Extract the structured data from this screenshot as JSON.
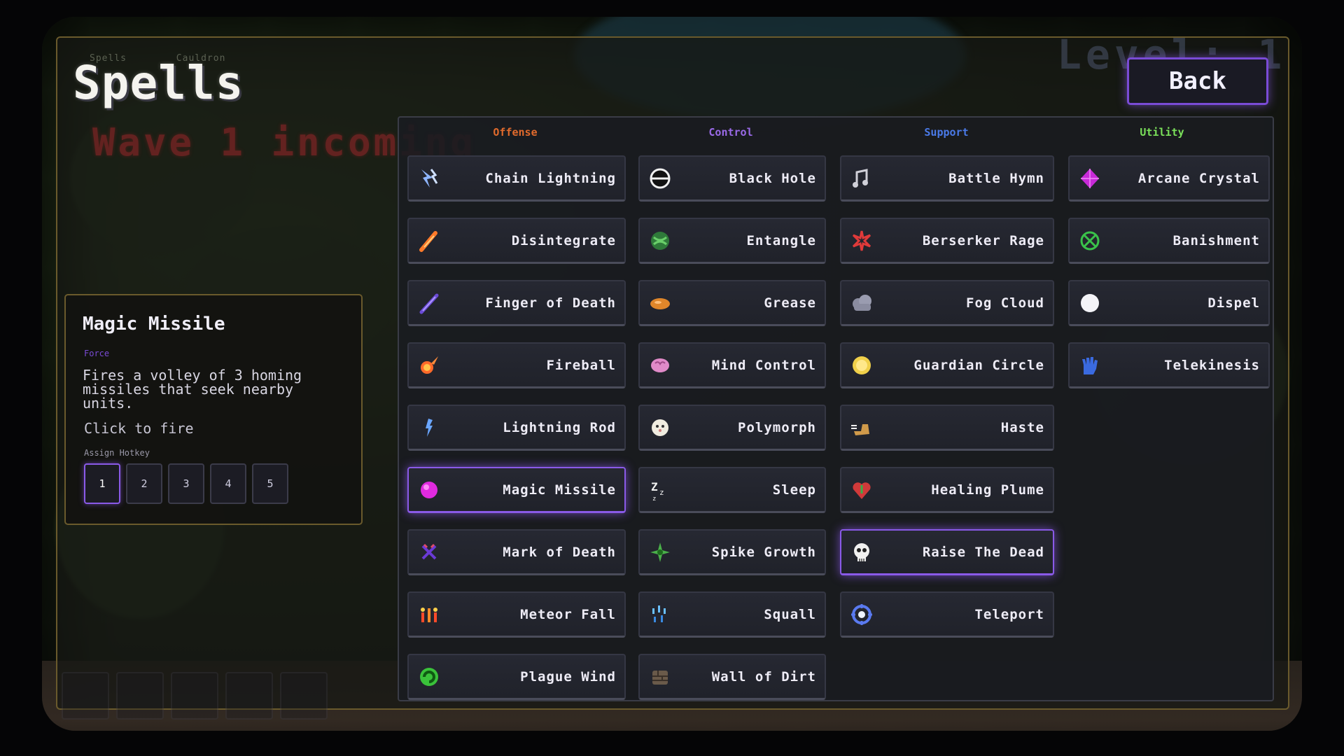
{
  "screen": {
    "title": "Spells",
    "ghost_tabs": [
      "Spells",
      "Cauldron"
    ],
    "wave_text": "Wave 1 incoming",
    "level_text": "Level: 1",
    "back_label": "Back"
  },
  "columns": [
    {
      "label": "Offense",
      "color": "#e06a2c"
    },
    {
      "label": "Control",
      "color": "#9a6ae8"
    },
    {
      "label": "Support",
      "color": "#4a7ae8"
    },
    {
      "label": "Utility",
      "color": "#7ae05a"
    }
  ],
  "spells": {
    "offense": [
      {
        "label": "Chain Lightning",
        "icon": "chain-lightning-icon"
      },
      {
        "label": "Disintegrate",
        "icon": "disintegrate-icon"
      },
      {
        "label": "Finger of Death",
        "icon": "finger-of-death-icon"
      },
      {
        "label": "Fireball",
        "icon": "fireball-icon"
      },
      {
        "label": "Lightning Rod",
        "icon": "lightning-rod-icon"
      },
      {
        "label": "Magic Missile",
        "icon": "magic-missile-icon",
        "selected": true
      },
      {
        "label": "Mark of Death",
        "icon": "mark-of-death-icon"
      },
      {
        "label": "Meteor Fall",
        "icon": "meteor-fall-icon"
      },
      {
        "label": "Plague Wind",
        "icon": "plague-wind-icon"
      }
    ],
    "control": [
      {
        "label": "Black Hole",
        "icon": "black-hole-icon"
      },
      {
        "label": "Entangle",
        "icon": "entangle-icon"
      },
      {
        "label": "Grease",
        "icon": "grease-icon"
      },
      {
        "label": "Mind Control",
        "icon": "mind-control-icon"
      },
      {
        "label": "Polymorph",
        "icon": "polymorph-icon"
      },
      {
        "label": "Sleep",
        "icon": "sleep-icon"
      },
      {
        "label": "Spike Growth",
        "icon": "spike-growth-icon"
      },
      {
        "label": "Squall",
        "icon": "squall-icon"
      },
      {
        "label": "Wall of Dirt",
        "icon": "wall-of-dirt-icon"
      }
    ],
    "support": [
      {
        "label": "Battle Hymn",
        "icon": "battle-hymn-icon"
      },
      {
        "label": "Berserker Rage",
        "icon": "berserker-rage-icon"
      },
      {
        "label": "Fog Cloud",
        "icon": "fog-cloud-icon"
      },
      {
        "label": "Guardian Circle",
        "icon": "guardian-circle-icon"
      },
      {
        "label": "Haste",
        "icon": "haste-icon"
      },
      {
        "label": "Healing Plume",
        "icon": "healing-plume-icon"
      },
      {
        "label": "Raise The Dead",
        "icon": "raise-the-dead-icon",
        "selected": true
      },
      {
        "label": "Teleport",
        "icon": "teleport-icon"
      }
    ],
    "utility": [
      {
        "label": "Arcane Crystal",
        "icon": "arcane-crystal-icon"
      },
      {
        "label": "Banishment",
        "icon": "banishment-icon"
      },
      {
        "label": "Dispel",
        "icon": "dispel-icon"
      },
      {
        "label": "Telekinesis",
        "icon": "telekinesis-icon"
      }
    ]
  },
  "info": {
    "name": "Magic Missile",
    "school": "Force",
    "description": "Fires a volley of 3 homing missiles that seek nearby units.",
    "action": "Click to fire",
    "hotkey_label": "Assign Hotkey",
    "hotkeys": [
      "1",
      "2",
      "3",
      "4",
      "5"
    ],
    "active_hotkey": "1"
  },
  "colors": {
    "accent": "#8a5ae8",
    "panel_border": "#6a5a2c"
  }
}
